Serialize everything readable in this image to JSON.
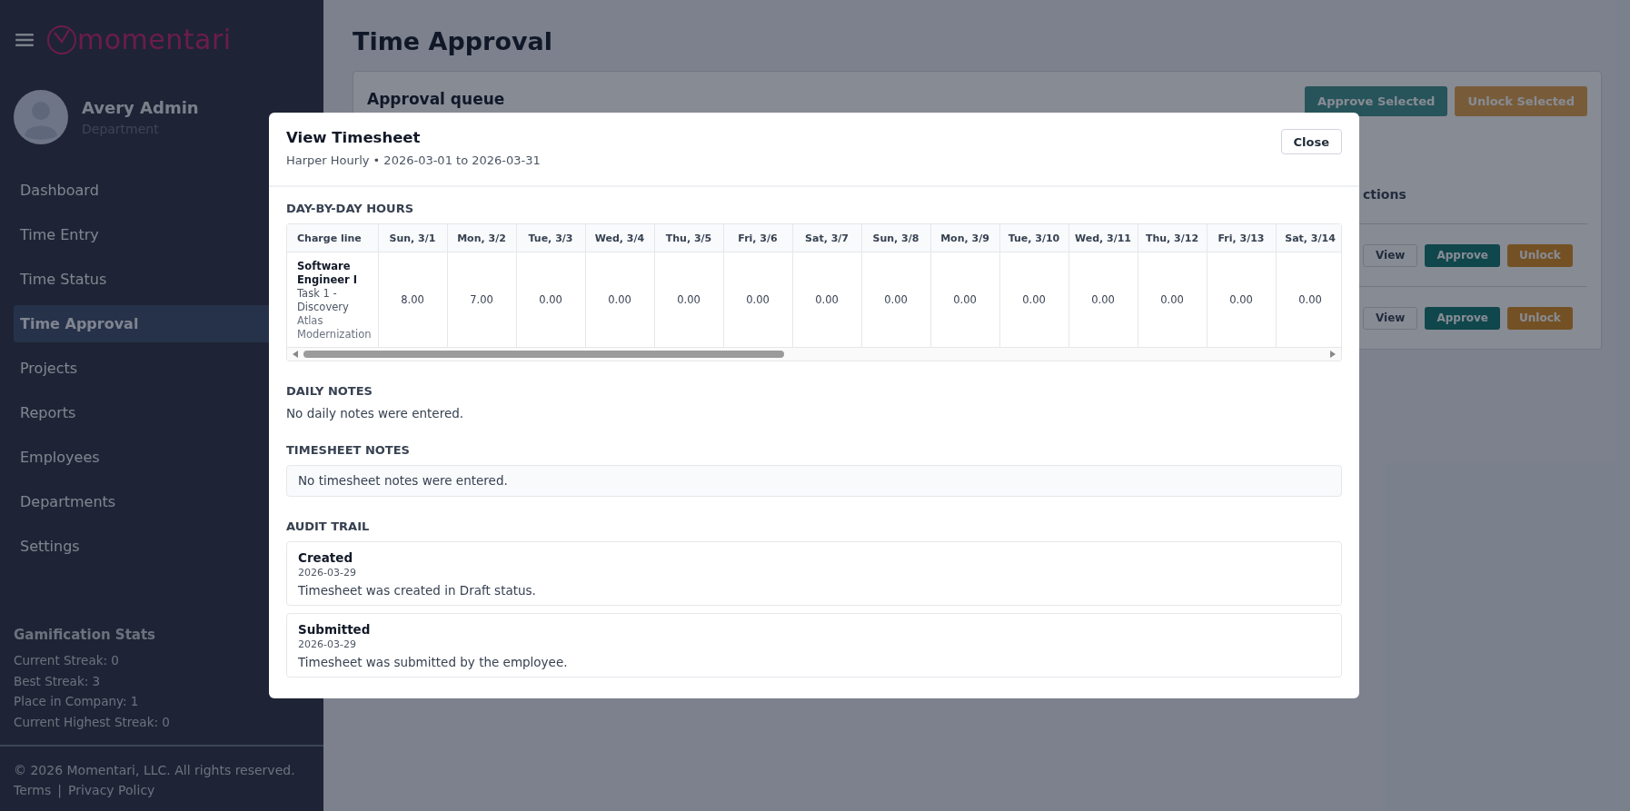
{
  "sidebar": {
    "brand": "momentari",
    "user": {
      "name": "Avery Admin",
      "department": "Department"
    },
    "nav": [
      {
        "label": "Dashboard",
        "selected": false
      },
      {
        "label": "Time Entry",
        "selected": false
      },
      {
        "label": "Time Status",
        "selected": false
      },
      {
        "label": "Time Approval",
        "selected": true
      },
      {
        "label": "Projects",
        "selected": false
      },
      {
        "label": "Reports",
        "selected": false
      },
      {
        "label": "Employees",
        "selected": false
      },
      {
        "label": "Departments",
        "selected": false
      },
      {
        "label": "Settings",
        "selected": false
      }
    ],
    "stats": {
      "title": "Gamification Stats",
      "lines": [
        "Current Streak: 0",
        "Best Streak: 3",
        "Place in Company: 1",
        "Current Highest Streak: 0"
      ]
    },
    "footer": {
      "copyright": "© 2026 Momentari, LLC. All rights reserved.",
      "links": [
        "Terms",
        "Privacy Policy"
      ],
      "separator": "|"
    }
  },
  "page": {
    "title": "Time Approval",
    "panel": {
      "title": "Approval queue",
      "buttons": [
        {
          "label": "Approve Selected",
          "kind": "approve",
          "disabled": true
        },
        {
          "label": "Unlock Selected",
          "kind": "unlock",
          "disabled": true
        }
      ],
      "column_header": "ctions",
      "rows": [
        {
          "actions": [
            {
              "label": "View",
              "kind": "view"
            },
            {
              "label": "Approve",
              "kind": "approve"
            },
            {
              "label": "Unlock",
              "kind": "unlock"
            }
          ]
        },
        {
          "actions": [
            {
              "label": "View",
              "kind": "view"
            },
            {
              "label": "Approve",
              "kind": "approve"
            },
            {
              "label": "Unlock",
              "kind": "unlock"
            }
          ]
        }
      ]
    }
  },
  "modal": {
    "title": "View Timesheet",
    "subtitle": "Harper Hourly • 2026-03-01 to 2026-03-31",
    "close_button": "Close",
    "hours": {
      "heading": "DAY-BY-DAY HOURS",
      "columns": [
        "Charge line",
        "Sun, 3/1",
        "Mon, 3/2",
        "Tue, 3/3",
        "Wed, 3/4",
        "Thu, 3/5",
        "Fri, 3/6",
        "Sat, 3/7",
        "Sun, 3/8",
        "Mon, 3/9",
        "Tue, 3/10",
        "Wed, 3/11",
        "Thu, 3/12",
        "Fri, 3/13",
        "Sat, 3/14"
      ],
      "rows": [
        {
          "role": "Software Engineer I",
          "task": "Task 1 - Discovery",
          "project": "Atlas Modernization",
          "hours": [
            "8.00",
            "7.00",
            "0.00",
            "0.00",
            "0.00",
            "0.00",
            "0.00",
            "0.00",
            "0.00",
            "0.00",
            "0.00",
            "0.00",
            "0.00",
            "0.00"
          ]
        }
      ]
    },
    "daily_notes": {
      "heading": "DAILY NOTES",
      "text": "No daily notes were entered."
    },
    "timesheet_notes": {
      "heading": "TIMESHEET NOTES",
      "text": "No timesheet notes were entered."
    },
    "audit_trail": {
      "heading": "AUDIT TRAIL",
      "entries": [
        {
          "event": "Created",
          "date": "2026-03-29",
          "description": "Timesheet was created in Draft status."
        },
        {
          "event": "Submitted",
          "date": "2026-03-29",
          "description": "Timesheet was submitted by the employee."
        }
      ]
    }
  }
}
